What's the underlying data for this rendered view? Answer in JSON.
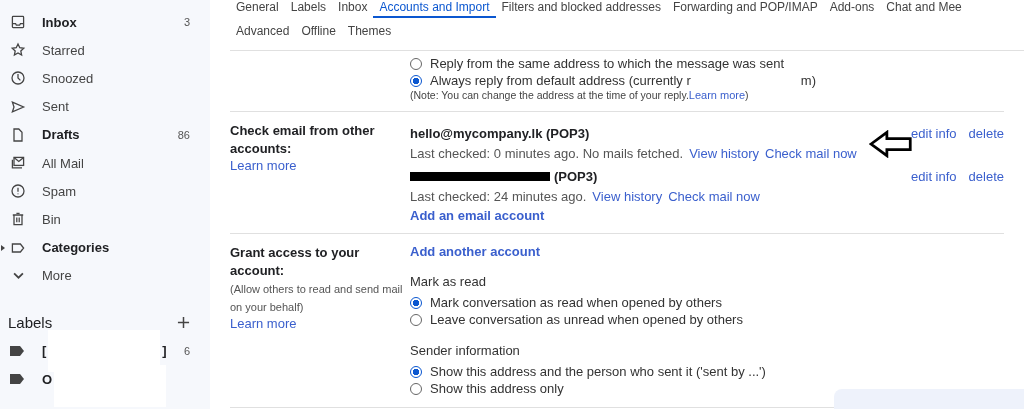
{
  "sidebar": {
    "items": [
      {
        "label": "Inbox",
        "count": "3",
        "bold": true,
        "kind": "inbox"
      },
      {
        "label": "Starred",
        "bold": false,
        "kind": "star"
      },
      {
        "label": "Snoozed",
        "bold": false,
        "kind": "clock"
      },
      {
        "label": "Sent",
        "bold": false,
        "kind": "send"
      },
      {
        "label": "Drafts",
        "count": "86",
        "bold": true,
        "kind": "file"
      },
      {
        "label": "All Mail",
        "bold": false,
        "kind": "mail"
      },
      {
        "label": "Spam",
        "bold": false,
        "kind": "alert"
      },
      {
        "label": "Bin",
        "bold": false,
        "kind": "bin"
      },
      {
        "label": "Categories",
        "bold": true,
        "kind": "label"
      },
      {
        "label": "More",
        "bold": false,
        "kind": "chevron"
      }
    ],
    "labels_title": "Labels",
    "labels": [
      {
        "name": "[",
        "end": "]",
        "count": "6"
      },
      {
        "name": "O"
      }
    ]
  },
  "tabs": [
    {
      "label": "General",
      "selected": false
    },
    {
      "label": "Labels",
      "selected": false
    },
    {
      "label": "Inbox",
      "selected": false
    },
    {
      "label": "Accounts and Import",
      "selected": true
    },
    {
      "label": "Filters and blocked addresses",
      "selected": false
    },
    {
      "label": "Forwarding and POP/IMAP",
      "selected": false
    },
    {
      "label": "Add-ons",
      "selected": false
    },
    {
      "label": "Chat and Mee",
      "selected": false
    },
    {
      "label": "Advanced",
      "selected": false
    },
    {
      "label": "Offline",
      "selected": false
    },
    {
      "label": "Themes",
      "selected": false
    }
  ],
  "reply_options": [
    {
      "label": "Reply from the same address to which the message was sent",
      "selected": false
    },
    {
      "label": "Always reply from default address (currently r",
      "label_end": "m)",
      "selected": true
    }
  ],
  "reply_note": "(Note: You can change the address at the time of your reply.",
  "reply_note_link": "Learn more",
  "reply_note_end": ")",
  "check_email": {
    "title": "Check email from other accounts:",
    "learn_more": "Learn more",
    "accounts": [
      {
        "address": "hello@mycompany.lk (POP3)",
        "redacted": false,
        "status": "Last checked: 0 minutes ago. No mails fetched.",
        "links": [
          "View history",
          "Check mail now"
        ],
        "actions": [
          "edit info",
          "delete"
        ]
      },
      {
        "address": "(POP3)",
        "redacted": true,
        "status": "Last checked: 24 minutes ago.",
        "links": [
          "View history",
          "Check mail now"
        ],
        "actions": [
          "edit info",
          "delete"
        ]
      }
    ],
    "add_account": "Add an email account"
  },
  "grant_access": {
    "title": "Grant access to your account:",
    "note": "(Allow others to read and send mail on your behalf)",
    "learn_more": "Learn more",
    "add_account": "Add another account",
    "mark_as_read": {
      "title": "Mark as read",
      "options": [
        {
          "label": "Mark conversation as read when opened by others",
          "selected": true
        },
        {
          "label": "Leave conversation as unread when opened by others",
          "selected": false
        }
      ]
    },
    "sender_info": {
      "title": "Sender information",
      "options": [
        {
          "label": "Show this address and the person who sent it ('sent by ...')",
          "selected": true
        },
        {
          "label": "Show this address only",
          "selected": false
        }
      ]
    }
  }
}
